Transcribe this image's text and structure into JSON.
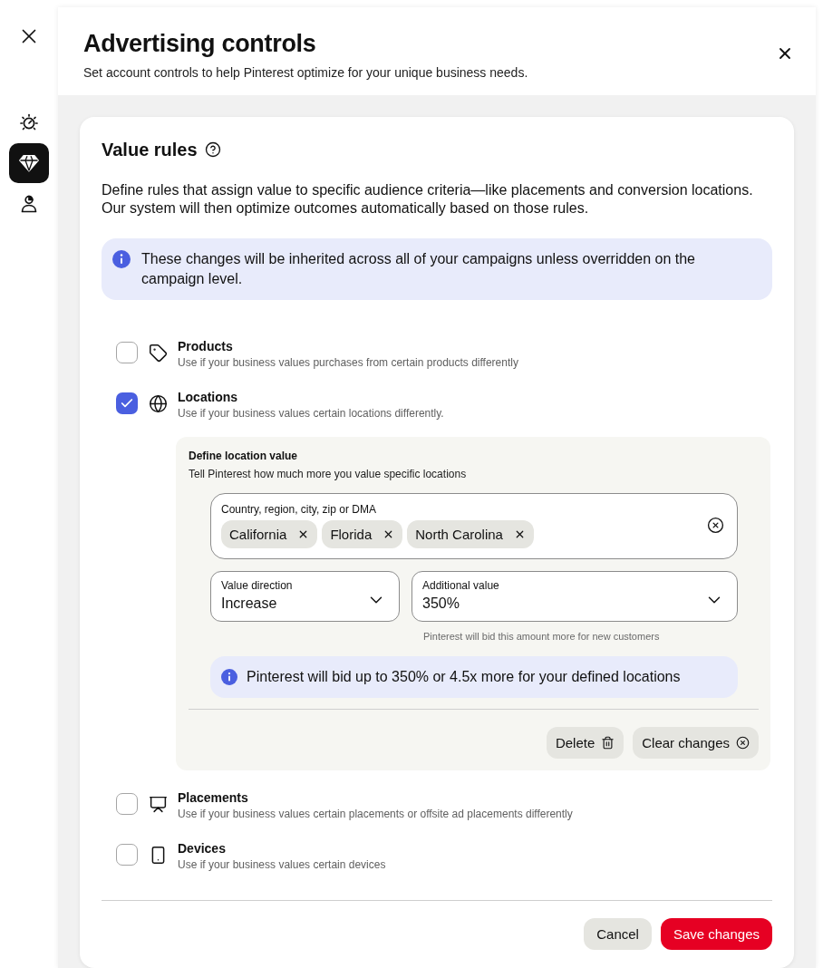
{
  "sidebar": {
    "items": [
      {
        "selected": false
      },
      {
        "selected": true
      },
      {
        "selected": false
      }
    ]
  },
  "header": {
    "title": "Advertising controls",
    "subtitle": "Set account controls to help Pinterest optimize for your unique business needs."
  },
  "value_rules": {
    "title": "Value rules",
    "description": "Define rules that assign value to specific audience criteria—like placements and conversion locations. Our system will then optimize outcomes automatically based on those rules.",
    "notice": "These changes will be inherited across all of your campaigns unless overridden on the campaign level.",
    "rules": [
      {
        "label": "Products",
        "description": "Use if your business values purchases from certain products differently",
        "checked": false
      },
      {
        "label": "Locations",
        "description": "Use if your business values certain locations differently.",
        "checked": true,
        "details": {
          "title": "Define location value",
          "description": "Tell Pinterest how much more you value specific locations",
          "location_field": {
            "label": "Country, region, city, zip or DMA",
            "chips": [
              "California",
              "Florida",
              "North Carolina"
            ]
          },
          "value_direction": {
            "label": "Value direction",
            "value": "Increase"
          },
          "additional_value": {
            "label": "Additional value",
            "value": "350%",
            "helper": "Pinterest will bid this amount more for new customers"
          },
          "notice": "Pinterest will bid up to 350% or 4.5x more for your defined locations",
          "buttons": [
            {
              "label": "Delete",
              "kind": "delete"
            },
            {
              "label": "Clear changes",
              "kind": "clear"
            }
          ]
        }
      },
      {
        "label": "Placements",
        "description": "Use if your business values certain placements or offsite ad placements differently",
        "checked": false
      },
      {
        "label": "Devices",
        "description": "Use if your business values certain devices",
        "checked": false
      }
    ],
    "buttons": [
      {
        "label": "Cancel",
        "kind": "secondary"
      },
      {
        "label": "Save changes",
        "kind": "primary"
      }
    ]
  }
}
